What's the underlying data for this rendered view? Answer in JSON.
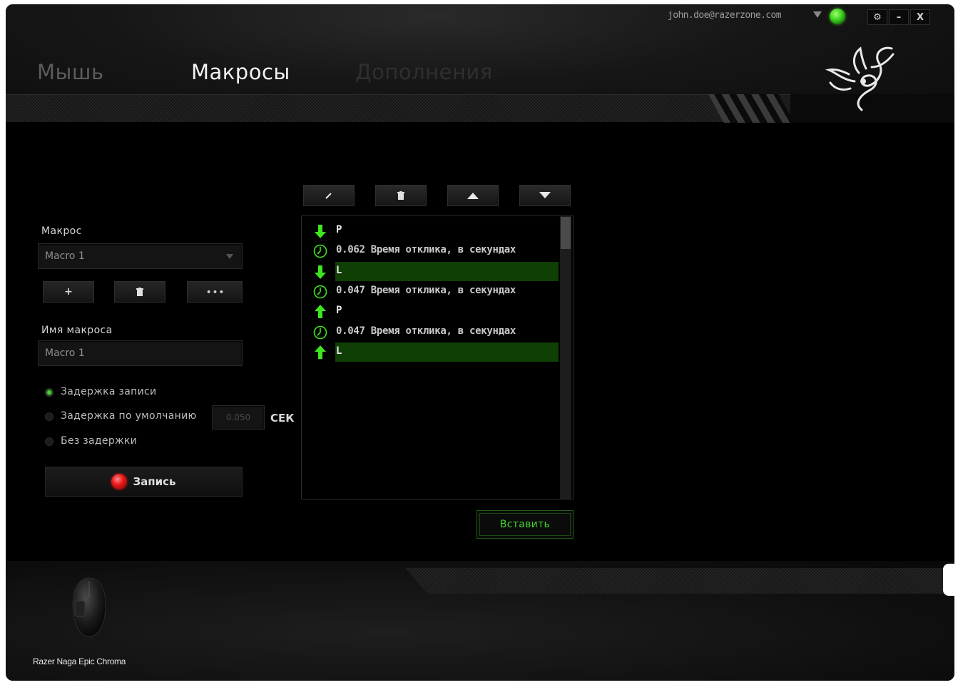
{
  "account": {
    "email": "john.doe@razerzone.com"
  },
  "window_controls": {
    "settings": "⚙",
    "minimize": "–",
    "close": "X"
  },
  "nav": {
    "tabs": [
      {
        "label": "Мышь",
        "active": false
      },
      {
        "label": "Макросы",
        "active": true
      },
      {
        "label": "Дополнения",
        "active": false
      }
    ]
  },
  "macro": {
    "label": "Макрос",
    "selected": "Macro 1",
    "buttons": {
      "add": "+",
      "delete": "🗑",
      "more": "• • •"
    }
  },
  "macro_name": {
    "label": "Имя макроса",
    "value": "Macro 1"
  },
  "delay_options": [
    {
      "label": "Задержка записи",
      "selected": true
    },
    {
      "label": "Задержка по умолчанию",
      "selected": false
    },
    {
      "label": "Без задержки",
      "selected": false
    }
  ],
  "default_delay": {
    "value": "0.050",
    "unit": "СЕК"
  },
  "record": {
    "label": "Запись"
  },
  "toolbar": {
    "edit": "✎",
    "delete": "🗑",
    "up": "▲",
    "down": "▼"
  },
  "events": [
    {
      "type": "key-down",
      "text": "P",
      "selected": false
    },
    {
      "type": "delay",
      "text": "0.062 Время отклика, в секундах",
      "selected": false
    },
    {
      "type": "key-down",
      "text": "L",
      "selected": true
    },
    {
      "type": "delay",
      "text": "0.047 Время отклика, в секундах",
      "selected": false
    },
    {
      "type": "key-up",
      "text": "P",
      "selected": false
    },
    {
      "type": "delay",
      "text": "0.047 Время отклика, в секундах",
      "selected": false
    },
    {
      "type": "key-up",
      "text": "L",
      "selected": true
    }
  ],
  "insert": {
    "label": "Вставить"
  },
  "device": {
    "name": "Razer Naga Epic Chroma"
  },
  "colors": {
    "accent": "#44d62c",
    "record": "#e81b1b",
    "selection": "#0f3f05"
  }
}
